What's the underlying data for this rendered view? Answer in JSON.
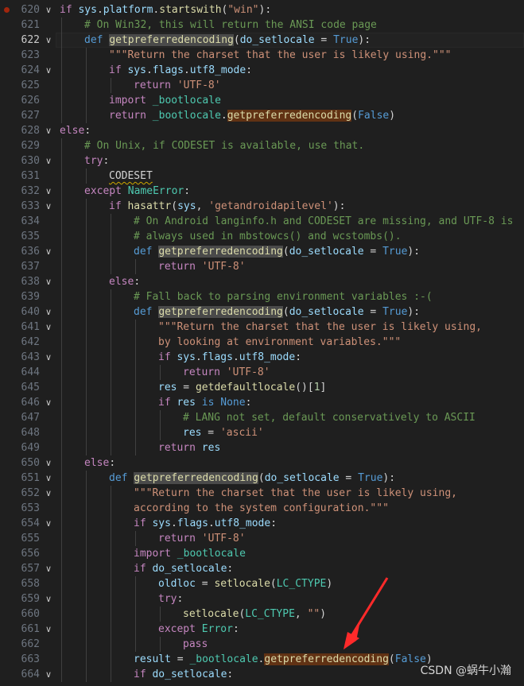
{
  "editor": {
    "language": "python",
    "current_line": 622,
    "lines": [
      {
        "num": "620",
        "indent": 0,
        "fold": "v",
        "breakpoint": true,
        "tokens": [
          {
            "t": "if ",
            "c": "k"
          },
          {
            "t": "sys",
            "c": "v"
          },
          {
            "t": ".",
            "c": "p"
          },
          {
            "t": "platform",
            "c": "v"
          },
          {
            "t": ".",
            "c": "p"
          },
          {
            "t": "startswith",
            "c": "f"
          },
          {
            "t": "(",
            "c": "p"
          },
          {
            "t": "\"win\"",
            "c": "s"
          },
          {
            "t": "):",
            "c": "p"
          }
        ]
      },
      {
        "num": "621",
        "indent": 1,
        "tokens": [
          {
            "t": "# On Win32, this will return the ANSI code page",
            "c": "c"
          }
        ]
      },
      {
        "num": "622",
        "indent": 1,
        "fold": "v",
        "current": true,
        "tokens": [
          {
            "t": "def ",
            "c": "d"
          },
          {
            "t": "getpreferredencoding",
            "c": "f",
            "hl": "h1"
          },
          {
            "t": "(",
            "c": "p"
          },
          {
            "t": "do_setlocale",
            "c": "v"
          },
          {
            "t": " = ",
            "c": "p"
          },
          {
            "t": "True",
            "c": "d"
          },
          {
            "t": "):",
            "c": "p"
          }
        ]
      },
      {
        "num": "623",
        "indent": 2,
        "tokens": [
          {
            "t": "\"\"\"Return the charset that the user is likely using.\"\"\"",
            "c": "s"
          }
        ]
      },
      {
        "num": "624",
        "indent": 2,
        "fold": "v",
        "tokens": [
          {
            "t": "if ",
            "c": "k"
          },
          {
            "t": "sys",
            "c": "v"
          },
          {
            "t": ".",
            "c": "p"
          },
          {
            "t": "flags",
            "c": "v"
          },
          {
            "t": ".",
            "c": "p"
          },
          {
            "t": "utf8_mode",
            "c": "v"
          },
          {
            "t": ":",
            "c": "p"
          }
        ]
      },
      {
        "num": "625",
        "indent": 3,
        "tokens": [
          {
            "t": "return ",
            "c": "k"
          },
          {
            "t": "'UTF-8'",
            "c": "s"
          }
        ]
      },
      {
        "num": "626",
        "indent": 2,
        "tokens": [
          {
            "t": "import ",
            "c": "k"
          },
          {
            "t": "_bootlocale",
            "c": "t"
          }
        ]
      },
      {
        "num": "627",
        "indent": 2,
        "tokens": [
          {
            "t": "return ",
            "c": "k"
          },
          {
            "t": "_bootlocale",
            "c": "t"
          },
          {
            "t": ".",
            "c": "p"
          },
          {
            "t": "getpreferredencoding",
            "c": "f",
            "hl": "h2"
          },
          {
            "t": "(",
            "c": "p"
          },
          {
            "t": "False",
            "c": "d"
          },
          {
            "t": ")",
            "c": "p"
          }
        ]
      },
      {
        "num": "628",
        "indent": 0,
        "fold": "v",
        "tokens": [
          {
            "t": "else",
            "c": "k"
          },
          {
            "t": ":",
            "c": "p"
          }
        ]
      },
      {
        "num": "629",
        "indent": 1,
        "tokens": [
          {
            "t": "# On Unix, if CODESET is available, use that.",
            "c": "c"
          }
        ]
      },
      {
        "num": "630",
        "indent": 1,
        "fold": "v",
        "tokens": [
          {
            "t": "try",
            "c": "k"
          },
          {
            "t": ":",
            "c": "p"
          }
        ]
      },
      {
        "num": "631",
        "indent": 2,
        "tokens": [
          {
            "t": "CODESET",
            "c": "p",
            "err": true
          }
        ]
      },
      {
        "num": "632",
        "indent": 1,
        "fold": "v",
        "tokens": [
          {
            "t": "except ",
            "c": "k"
          },
          {
            "t": "NameError",
            "c": "t"
          },
          {
            "t": ":",
            "c": "p"
          }
        ]
      },
      {
        "num": "633",
        "indent": 2,
        "fold": "v",
        "tokens": [
          {
            "t": "if ",
            "c": "k"
          },
          {
            "t": "hasattr",
            "c": "f"
          },
          {
            "t": "(",
            "c": "p"
          },
          {
            "t": "sys",
            "c": "v"
          },
          {
            "t": ", ",
            "c": "p"
          },
          {
            "t": "'getandroidapilevel'",
            "c": "s"
          },
          {
            "t": "):",
            "c": "p"
          }
        ]
      },
      {
        "num": "634",
        "indent": 3,
        "tokens": [
          {
            "t": "# On Android langinfo.h and CODESET are missing, and UTF-8 is",
            "c": "c"
          }
        ]
      },
      {
        "num": "635",
        "indent": 3,
        "tokens": [
          {
            "t": "# always used in mbstowcs() and wcstombs().",
            "c": "c"
          }
        ]
      },
      {
        "num": "636",
        "indent": 3,
        "fold": "v",
        "tokens": [
          {
            "t": "def ",
            "c": "d"
          },
          {
            "t": "getpreferredencoding",
            "c": "f",
            "hl": "h1"
          },
          {
            "t": "(",
            "c": "p"
          },
          {
            "t": "do_setlocale",
            "c": "v"
          },
          {
            "t": " = ",
            "c": "p"
          },
          {
            "t": "True",
            "c": "d"
          },
          {
            "t": "):",
            "c": "p"
          }
        ]
      },
      {
        "num": "637",
        "indent": 4,
        "tokens": [
          {
            "t": "return ",
            "c": "k"
          },
          {
            "t": "'UTF-8'",
            "c": "s"
          }
        ]
      },
      {
        "num": "638",
        "indent": 2,
        "fold": "v",
        "tokens": [
          {
            "t": "else",
            "c": "k"
          },
          {
            "t": ":",
            "c": "p"
          }
        ]
      },
      {
        "num": "639",
        "indent": 3,
        "tokens": [
          {
            "t": "# Fall back to parsing environment variables :-(",
            "c": "c"
          }
        ]
      },
      {
        "num": "640",
        "indent": 3,
        "fold": "v",
        "tokens": [
          {
            "t": "def ",
            "c": "d"
          },
          {
            "t": "getpreferredencoding",
            "c": "f",
            "hl": "h1"
          },
          {
            "t": "(",
            "c": "p"
          },
          {
            "t": "do_setlocale",
            "c": "v"
          },
          {
            "t": " = ",
            "c": "p"
          },
          {
            "t": "True",
            "c": "d"
          },
          {
            "t": "):",
            "c": "p"
          }
        ]
      },
      {
        "num": "641",
        "indent": 4,
        "fold": "v",
        "tokens": [
          {
            "t": "\"\"\"Return the charset that the user is likely using,",
            "c": "s"
          }
        ]
      },
      {
        "num": "642",
        "indent": 4,
        "tokens": [
          {
            "t": "by looking at environment variables.\"\"\"",
            "c": "s"
          }
        ]
      },
      {
        "num": "643",
        "indent": 4,
        "fold": "v",
        "tokens": [
          {
            "t": "if ",
            "c": "k"
          },
          {
            "t": "sys",
            "c": "v"
          },
          {
            "t": ".",
            "c": "p"
          },
          {
            "t": "flags",
            "c": "v"
          },
          {
            "t": ".",
            "c": "p"
          },
          {
            "t": "utf8_mode",
            "c": "v"
          },
          {
            "t": ":",
            "c": "p"
          }
        ]
      },
      {
        "num": "644",
        "indent": 5,
        "tokens": [
          {
            "t": "return ",
            "c": "k"
          },
          {
            "t": "'UTF-8'",
            "c": "s"
          }
        ]
      },
      {
        "num": "645",
        "indent": 4,
        "tokens": [
          {
            "t": "res",
            "c": "v"
          },
          {
            "t": " = ",
            "c": "p"
          },
          {
            "t": "getdefaultlocale",
            "c": "f"
          },
          {
            "t": "()[",
            "c": "p"
          },
          {
            "t": "1",
            "c": "n"
          },
          {
            "t": "]",
            "c": "p"
          }
        ]
      },
      {
        "num": "646",
        "indent": 4,
        "fold": "v",
        "tokens": [
          {
            "t": "if ",
            "c": "k"
          },
          {
            "t": "res",
            "c": "v"
          },
          {
            "t": " is ",
            "c": "d"
          },
          {
            "t": "None",
            "c": "d"
          },
          {
            "t": ":",
            "c": "p"
          }
        ]
      },
      {
        "num": "647",
        "indent": 5,
        "tokens": [
          {
            "t": "# LANG not set, default conservatively to ASCII",
            "c": "c"
          }
        ]
      },
      {
        "num": "648",
        "indent": 5,
        "tokens": [
          {
            "t": "res",
            "c": "v"
          },
          {
            "t": " = ",
            "c": "p"
          },
          {
            "t": "'ascii'",
            "c": "s"
          }
        ]
      },
      {
        "num": "649",
        "indent": 4,
        "tokens": [
          {
            "t": "return ",
            "c": "k"
          },
          {
            "t": "res",
            "c": "v"
          }
        ]
      },
      {
        "num": "650",
        "indent": 1,
        "fold": "v",
        "tokens": [
          {
            "t": "else",
            "c": "k"
          },
          {
            "t": ":",
            "c": "p"
          }
        ]
      },
      {
        "num": "651",
        "indent": 2,
        "fold": "v",
        "tokens": [
          {
            "t": "def ",
            "c": "d"
          },
          {
            "t": "getpreferredencoding",
            "c": "f",
            "hl": "h1"
          },
          {
            "t": "(",
            "c": "p"
          },
          {
            "t": "do_setlocale",
            "c": "v"
          },
          {
            "t": " = ",
            "c": "p"
          },
          {
            "t": "True",
            "c": "d"
          },
          {
            "t": "):",
            "c": "p"
          }
        ]
      },
      {
        "num": "652",
        "indent": 3,
        "fold": "v",
        "tokens": [
          {
            "t": "\"\"\"Return the charset that the user is likely using,",
            "c": "s"
          }
        ]
      },
      {
        "num": "653",
        "indent": 3,
        "tokens": [
          {
            "t": "according to the system configuration.\"\"\"",
            "c": "s"
          }
        ]
      },
      {
        "num": "654",
        "indent": 3,
        "fold": "v",
        "tokens": [
          {
            "t": "if ",
            "c": "k"
          },
          {
            "t": "sys",
            "c": "v"
          },
          {
            "t": ".",
            "c": "p"
          },
          {
            "t": "flags",
            "c": "v"
          },
          {
            "t": ".",
            "c": "p"
          },
          {
            "t": "utf8_mode",
            "c": "v"
          },
          {
            "t": ":",
            "c": "p"
          }
        ]
      },
      {
        "num": "655",
        "indent": 4,
        "tokens": [
          {
            "t": "return ",
            "c": "k"
          },
          {
            "t": "'UTF-8'",
            "c": "s"
          }
        ]
      },
      {
        "num": "656",
        "indent": 3,
        "tokens": [
          {
            "t": "import ",
            "c": "k"
          },
          {
            "t": "_bootlocale",
            "c": "t"
          }
        ]
      },
      {
        "num": "657",
        "indent": 3,
        "fold": "v",
        "tokens": [
          {
            "t": "if ",
            "c": "k"
          },
          {
            "t": "do_setlocale",
            "c": "v"
          },
          {
            "t": ":",
            "c": "p"
          }
        ]
      },
      {
        "num": "658",
        "indent": 4,
        "tokens": [
          {
            "t": "oldloc",
            "c": "v"
          },
          {
            "t": " = ",
            "c": "p"
          },
          {
            "t": "setlocale",
            "c": "f"
          },
          {
            "t": "(",
            "c": "p"
          },
          {
            "t": "LC_CTYPE",
            "c": "t"
          },
          {
            "t": ")",
            "c": "p"
          }
        ]
      },
      {
        "num": "659",
        "indent": 4,
        "fold": "v",
        "tokens": [
          {
            "t": "try",
            "c": "k"
          },
          {
            "t": ":",
            "c": "p"
          }
        ]
      },
      {
        "num": "660",
        "indent": 5,
        "tokens": [
          {
            "t": "setlocale",
            "c": "f"
          },
          {
            "t": "(",
            "c": "p"
          },
          {
            "t": "LC_CTYPE",
            "c": "t"
          },
          {
            "t": ", ",
            "c": "p"
          },
          {
            "t": "\"\"",
            "c": "s"
          },
          {
            "t": ")",
            "c": "p"
          }
        ]
      },
      {
        "num": "661",
        "indent": 4,
        "fold": "v",
        "tokens": [
          {
            "t": "except ",
            "c": "k"
          },
          {
            "t": "Error",
            "c": "t"
          },
          {
            "t": ":",
            "c": "p"
          }
        ]
      },
      {
        "num": "662",
        "indent": 5,
        "tokens": [
          {
            "t": "pass",
            "c": "k"
          }
        ]
      },
      {
        "num": "663",
        "indent": 3,
        "tokens": [
          {
            "t": "result",
            "c": "v"
          },
          {
            "t": " = ",
            "c": "p"
          },
          {
            "t": "_bootlocale",
            "c": "t"
          },
          {
            "t": ".",
            "c": "p"
          },
          {
            "t": "getpreferredencoding",
            "c": "f",
            "hl": "h2"
          },
          {
            "t": "(",
            "c": "p"
          },
          {
            "t": "False",
            "c": "d"
          },
          {
            "t": ")",
            "c": "p"
          }
        ]
      },
      {
        "num": "664",
        "indent": 3,
        "fold": "v",
        "tokens": [
          {
            "t": "if ",
            "c": "k"
          },
          {
            "t": "do_setlocale",
            "c": "v"
          },
          {
            "t": ":",
            "c": "p"
          }
        ]
      }
    ]
  },
  "annotation": {
    "kind": "arrow",
    "color": "#ff2a2a"
  },
  "watermark": "CSDN @蜗牛小瀚",
  "colors": {
    "background": "#1f1f1f",
    "line_number": "#6e7681",
    "keyword": "#c586c0",
    "def_keyword": "#569cd6",
    "function": "#dcdcaa",
    "string": "#ce9178",
    "comment": "#6a9955",
    "variable": "#9cdcfe",
    "type": "#4ec9b0",
    "breakpoint": "#a1260d",
    "highlight": "#4a4a4a",
    "highlight_alt": "#613214"
  }
}
